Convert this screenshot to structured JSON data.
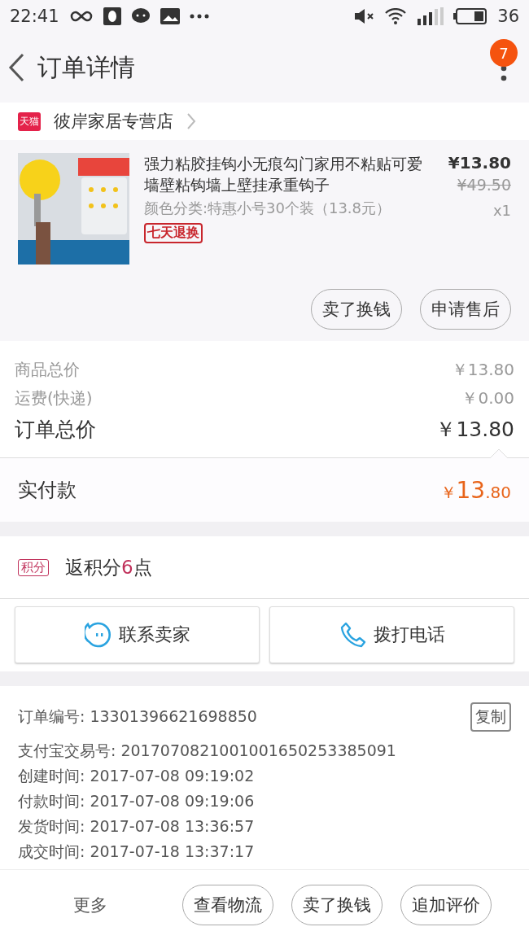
{
  "status_bar": {
    "time": "22:41",
    "battery": "36"
  },
  "header": {
    "title": "订单详情",
    "badge": "7"
  },
  "store": {
    "tag": "天猫",
    "name": "彼岸家居专营店"
  },
  "product": {
    "image": {
      "kind": "picture"
    },
    "title": "强力粘胶挂钩小无痕勾门家用不粘贴可爱墙壁粘钩墙上壁挂承重钩子",
    "sku": "颜色分类:特惠小号30个装（13.8元）",
    "service_tag": "七天退换",
    "price": "¥13.80",
    "original_price": "¥49.50",
    "quantity": "x1",
    "actions": [
      "卖了换钱",
      "申请售后"
    ]
  },
  "totals": [
    {
      "label": "商品总价",
      "value": "￥13.80",
      "kind": "minor"
    },
    {
      "label": "运费(快递)",
      "value": "￥0.00",
      "kind": "minor"
    },
    {
      "label": "订单总价",
      "value": "￥13.80",
      "kind": "major"
    }
  ],
  "paid": {
    "label": "实付款",
    "currency": "￥",
    "integer": "13",
    "fraction": ".80"
  },
  "points": {
    "tag": "积分",
    "before": "返积分",
    "value": "6",
    "after": "点"
  },
  "contact_buttons": [
    {
      "label": "联系卖家",
      "kind": "chat"
    },
    {
      "label": "拨打电话",
      "kind": "phone"
    }
  ],
  "order_info": {
    "copy_button": "复制",
    "rows": [
      {
        "label": "订单编号:",
        "value": "13301396621698850"
      },
      {
        "label": "支付宝交易号:",
        "value": "2017070821001001650253385091"
      },
      {
        "label": "创建时间:",
        "value": "2017-07-08 09:19:02"
      },
      {
        "label": "付款时间:",
        "value": "2017-07-08 09:19:06"
      },
      {
        "label": "发货时间:",
        "value": "2017-07-08 13:36:57"
      },
      {
        "label": "成交时间:",
        "value": "2017-07-18 13:37:17"
      }
    ]
  },
  "bottom_bar": {
    "more": "更多",
    "buttons": [
      "查看物流",
      "卖了换钱",
      "追加评价"
    ]
  }
}
